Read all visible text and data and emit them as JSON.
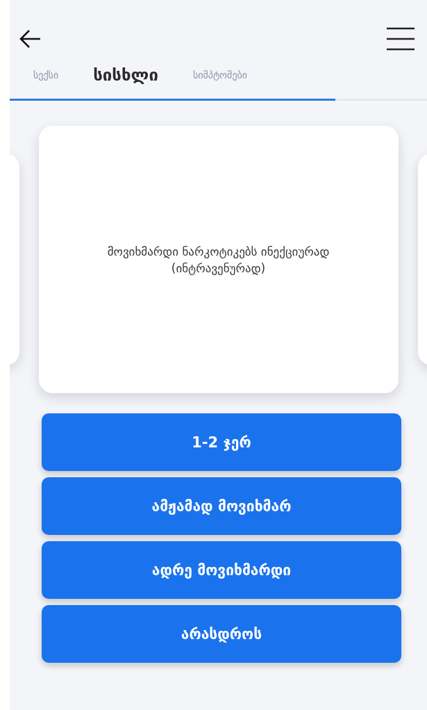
{
  "tabs": [
    {
      "label": "სექსი",
      "selected": false
    },
    {
      "label": "სისხლი",
      "selected": true
    },
    {
      "label": "სიმპტომები",
      "selected": false
    }
  ],
  "progress": {
    "level": 0.78
  },
  "card": {
    "question": "მოვიხმარდი ნარკოტიკებს ინექციურად (ინტრავენურად)"
  },
  "answers": [
    "1-2 ჯერ",
    "ამჟამად მოვიხმარ",
    "ადრე მოვიხმარდი",
    "არასდროს"
  ]
}
